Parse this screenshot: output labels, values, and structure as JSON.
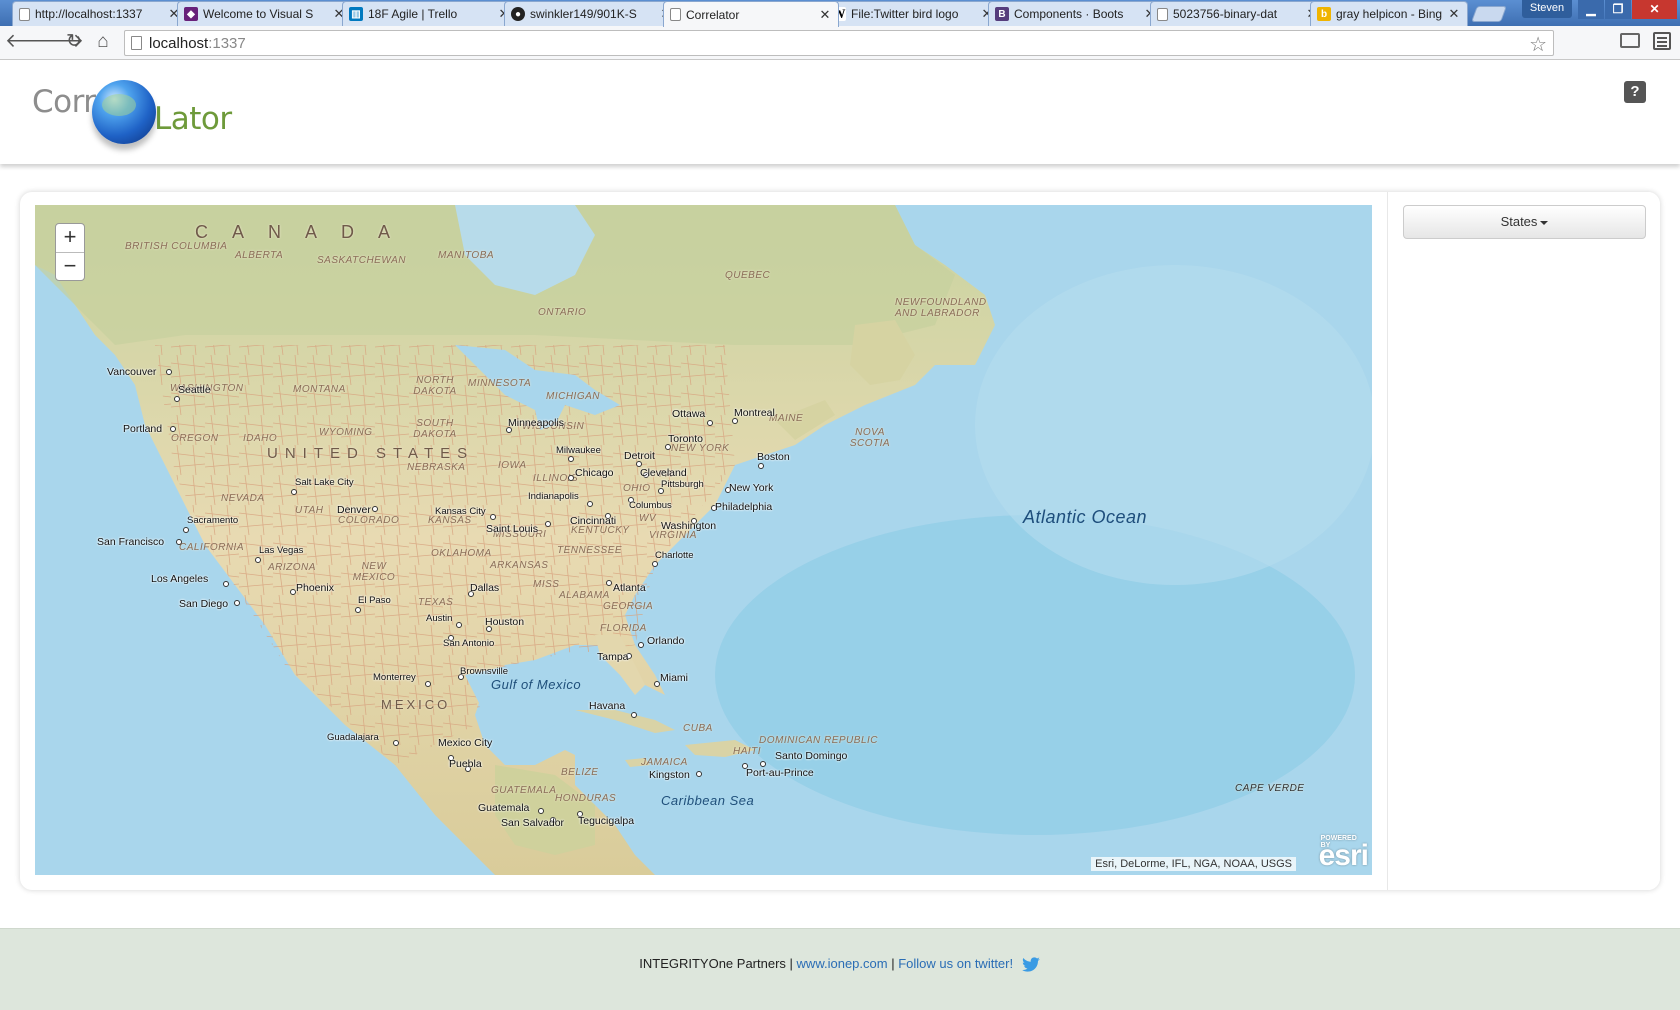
{
  "browser": {
    "tabs": [
      {
        "title": "http://localhost:1337",
        "icon": "page-icon"
      },
      {
        "title": "Welcome to Visual S",
        "icon": "visual-studio-icon"
      },
      {
        "title": "18F Agile | Trello",
        "icon": "trello-icon"
      },
      {
        "title": "swinkler149/901K-S",
        "icon": "github-icon"
      },
      {
        "title": "Correlator",
        "icon": "page-icon"
      },
      {
        "title": "File:Twitter bird logo",
        "icon": "wikipedia-icon"
      },
      {
        "title": "Components · Boots",
        "icon": "bootstrap-icon"
      },
      {
        "title": "5023756-binary-dat",
        "icon": "page-icon"
      },
      {
        "title": "gray helpicon - Bing",
        "icon": "bing-icon"
      }
    ],
    "active_tab_index": 4,
    "user": "Steven",
    "address": {
      "host": "localhost",
      "port": ":1337"
    }
  },
  "header": {
    "logo_left": "Corr",
    "logo_right": "Lator",
    "help_label": "?"
  },
  "map": {
    "zoom_in": "+",
    "zoom_out": "−",
    "attribution": "Esri, DeLorme, IFL, NGA, NOAA, USGS",
    "esri_logo": "esri",
    "esri_powered": "POWERED BY",
    "labels": {
      "canada": "C A N A D A",
      "us": "UNITED STATES",
      "mexico": "MEXICO",
      "atlantic": "Atlantic Ocean",
      "gulf": "Gulf of Mexico",
      "caribbean": "Caribbean Sea",
      "states": [
        "BRITISH COLUMBIA",
        "ALBERTA",
        "SASKATCHEWAN",
        "MANITOBA",
        "ONTARIO",
        "QUEBEC",
        "NEWFOUNDLAND AND LABRADOR",
        "WASHINGTON",
        "MONTANA",
        "NORTH DAKOTA",
        "MINNESOTA",
        "MICHIGAN",
        "OREGON",
        "IDAHO",
        "WYOMING",
        "SOUTH DAKOTA",
        "WISCONSIN",
        "NEW YORK",
        "MAINE",
        "NOVA SCOTIA",
        "NEVADA",
        "NEBRASKA",
        "IOWA",
        "ILLINOIS",
        "OHIO",
        "PA",
        "UTAH",
        "COLORADO",
        "KANSAS",
        "MISSOURI",
        "KENTUCKY",
        "WV",
        "VIRGINIA",
        "CALIFORNIA",
        "ARIZONA",
        "NEW MEXICO",
        "OKLAHOMA",
        "TENNESSEE",
        "ARKANSAS",
        "MISS",
        "ALABAMA",
        "GEORGIA",
        "TEXAS",
        "FLORIDA",
        "CUBA",
        "BELIZE",
        "JAMAICA",
        "HAITI",
        "DOMINICAN REPUBLIC",
        "GUATEMALA",
        "HONDURAS",
        "CAPE VERDE"
      ],
      "cities": [
        "Vancouver",
        "Seattle",
        "Portland",
        "San Francisco",
        "Sacramento",
        "Las Vegas",
        "Los Angeles",
        "San Diego",
        "Phoenix",
        "Salt Lake City",
        "Denver",
        "El Paso",
        "Kansas City",
        "Saint Louis",
        "Minneapolis",
        "Milwaukee",
        "Chicago",
        "Indianapolis",
        "Detroit",
        "Cleveland",
        "Cincinnati",
        "Columbus",
        "Pittsburgh",
        "Washington",
        "Philadelphia",
        "New York",
        "Boston",
        "Ottawa",
        "Montreal",
        "Toronto",
        "Charlotte",
        "Atlanta",
        "Dallas",
        "Austin",
        "Houston",
        "San Antonio",
        "Orlando",
        "Tampa",
        "Miami",
        "Monterrey",
        "Brownsville",
        "Havana",
        "Guadalajara",
        "Mexico City",
        "Puebla",
        "Kingston",
        "Santo Domingo",
        "Port-au-Prince",
        "Guatemala",
        "San Salvador",
        "Tegucigalpa"
      ]
    }
  },
  "sidebar": {
    "states_button": "States"
  },
  "footer": {
    "company": "INTEGRITYOne Partners",
    "separator": "|",
    "website": "www.ionep.com",
    "twitter_text": "Follow us on twitter!"
  },
  "colors": {
    "land": "#e9dcb5",
    "forest": "#cdd6a6",
    "ocean": "#a9d6ec",
    "deep_ocean": "#8ccbe6",
    "roads": "#d8a37f",
    "link": "#2a6db5",
    "footer_bg": "#dde6dc"
  }
}
